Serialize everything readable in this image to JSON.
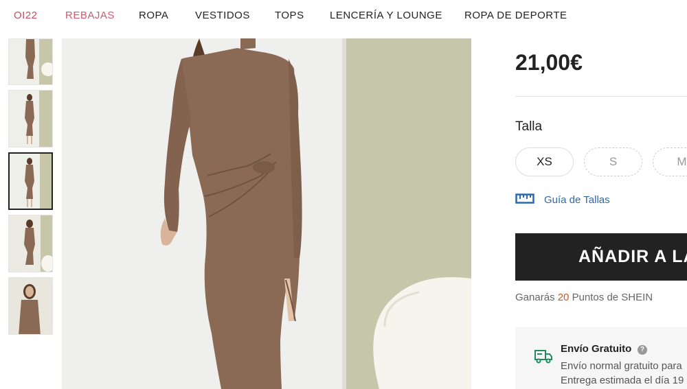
{
  "nav": {
    "items": [
      {
        "label": "OI22"
      },
      {
        "label": "REBAJAS"
      },
      {
        "label": "ROPA"
      },
      {
        "label": "VESTIDOS"
      },
      {
        "label": "TOPS"
      },
      {
        "label": "LENCERÍA Y LOUNGE"
      },
      {
        "label": "ROPA DE DEPORTE"
      }
    ]
  },
  "gallery": {
    "thumbnail_count": 5,
    "selected_index": 2
  },
  "product": {
    "price": "21,00€",
    "size_title": "Talla",
    "sizes": [
      {
        "label": "XS",
        "available": true
      },
      {
        "label": "S",
        "available": false
      },
      {
        "label": "M",
        "available": false
      }
    ],
    "size_guide": "Guía de Tallas",
    "add_to_cart": "AÑADIR A LA CESTA",
    "points": {
      "prefix": "Ganarás",
      "value": "20",
      "suffix": "Puntos de SHEIN"
    }
  },
  "shipping": {
    "title": "Envío Gratuito",
    "line1": "Envío normal gratuito para",
    "line2": "Entrega estimada el día 19"
  },
  "colors": {
    "accent_sale": "#d4576b",
    "link": "#2d68a8",
    "cta": "#222222",
    "points": "#c9592b",
    "dress": "#8a6a55"
  }
}
